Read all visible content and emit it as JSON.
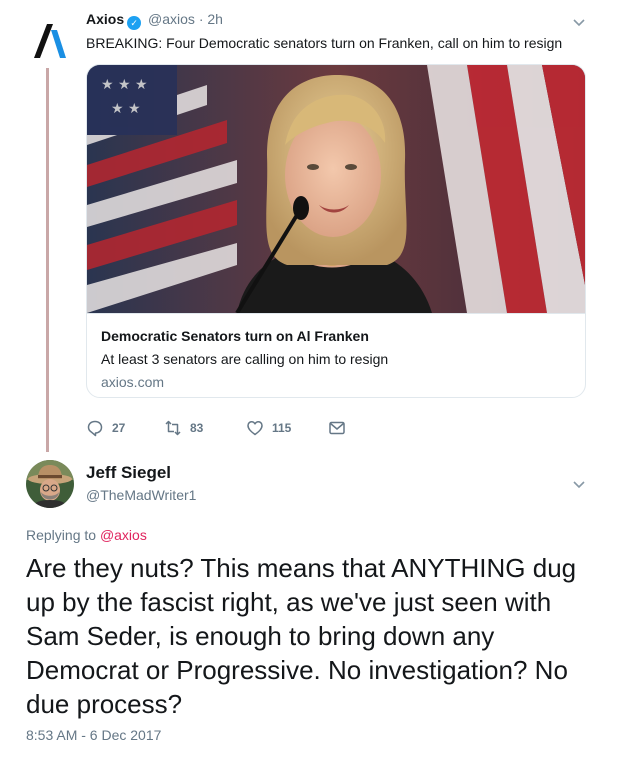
{
  "parent_tweet": {
    "author_name": "Axios",
    "author_handle": "@axios",
    "separator": "·",
    "time": "2h",
    "text": "BREAKING: Four Democratic senators turn on Franken, call on him to resign",
    "card": {
      "title": "Democratic Senators turn on Al Franken",
      "description": "At least 3 senators are calling on him to resign",
      "domain": "axios.com"
    },
    "actions": {
      "replies": "27",
      "retweets": "83",
      "likes": "115"
    }
  },
  "tweet": {
    "author_name": "Jeff Siegel",
    "author_handle": "@TheMadWriter1",
    "replying_prefix": "Replying to",
    "replying_handle": "@axios",
    "text": "Are they nuts? This means that ANYTHING dug up by the fascist right, as we've just seen with Sam Seder, is enough to bring down any Democrat or Progressive. No investigation? No due process?",
    "timestamp": "8:53 AM - 6 Dec 2017"
  },
  "colors": {
    "link": "#e0245e",
    "muted": "#657786",
    "verified": "#1da1f2",
    "thread_line": "#c9a7a7"
  },
  "icons": [
    "axios-logo-icon",
    "verified-icon",
    "chevron-down-icon",
    "reply-icon",
    "retweet-icon",
    "like-icon",
    "direct-message-icon"
  ]
}
